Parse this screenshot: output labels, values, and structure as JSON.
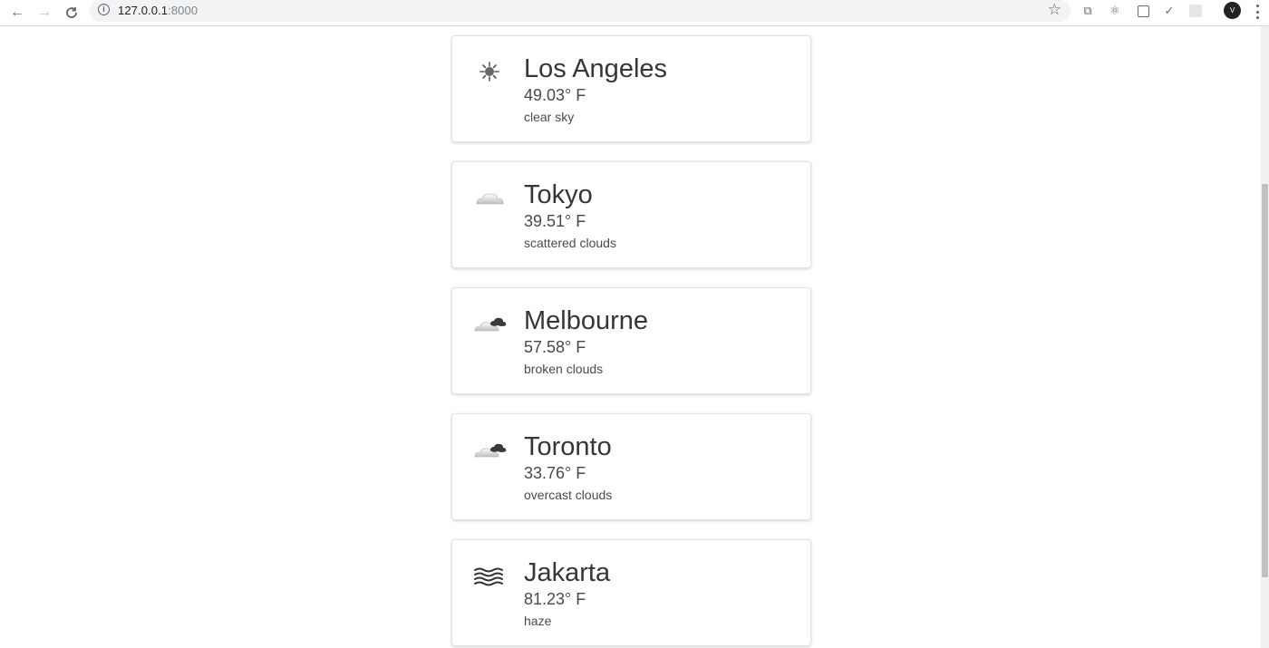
{
  "browser": {
    "url_host": "127.0.0.1",
    "url_port": ":8000",
    "avatar_letter": "V"
  },
  "cities": [
    {
      "name": "Los Angeles",
      "temperature": "49.03° F",
      "description": "clear sky",
      "icon": "sun-icon"
    },
    {
      "name": "Tokyo",
      "temperature": "39.51° F",
      "description": "scattered clouds",
      "icon": "cloud-icon"
    },
    {
      "name": "Melbourne",
      "temperature": "57.58° F",
      "description": "broken clouds",
      "icon": "broken-clouds-icon"
    },
    {
      "name": "Toronto",
      "temperature": "33.76° F",
      "description": "overcast clouds",
      "icon": "broken-clouds-icon"
    },
    {
      "name": "Jakarta",
      "temperature": "81.23° F",
      "description": "haze",
      "icon": "haze-icon"
    }
  ]
}
